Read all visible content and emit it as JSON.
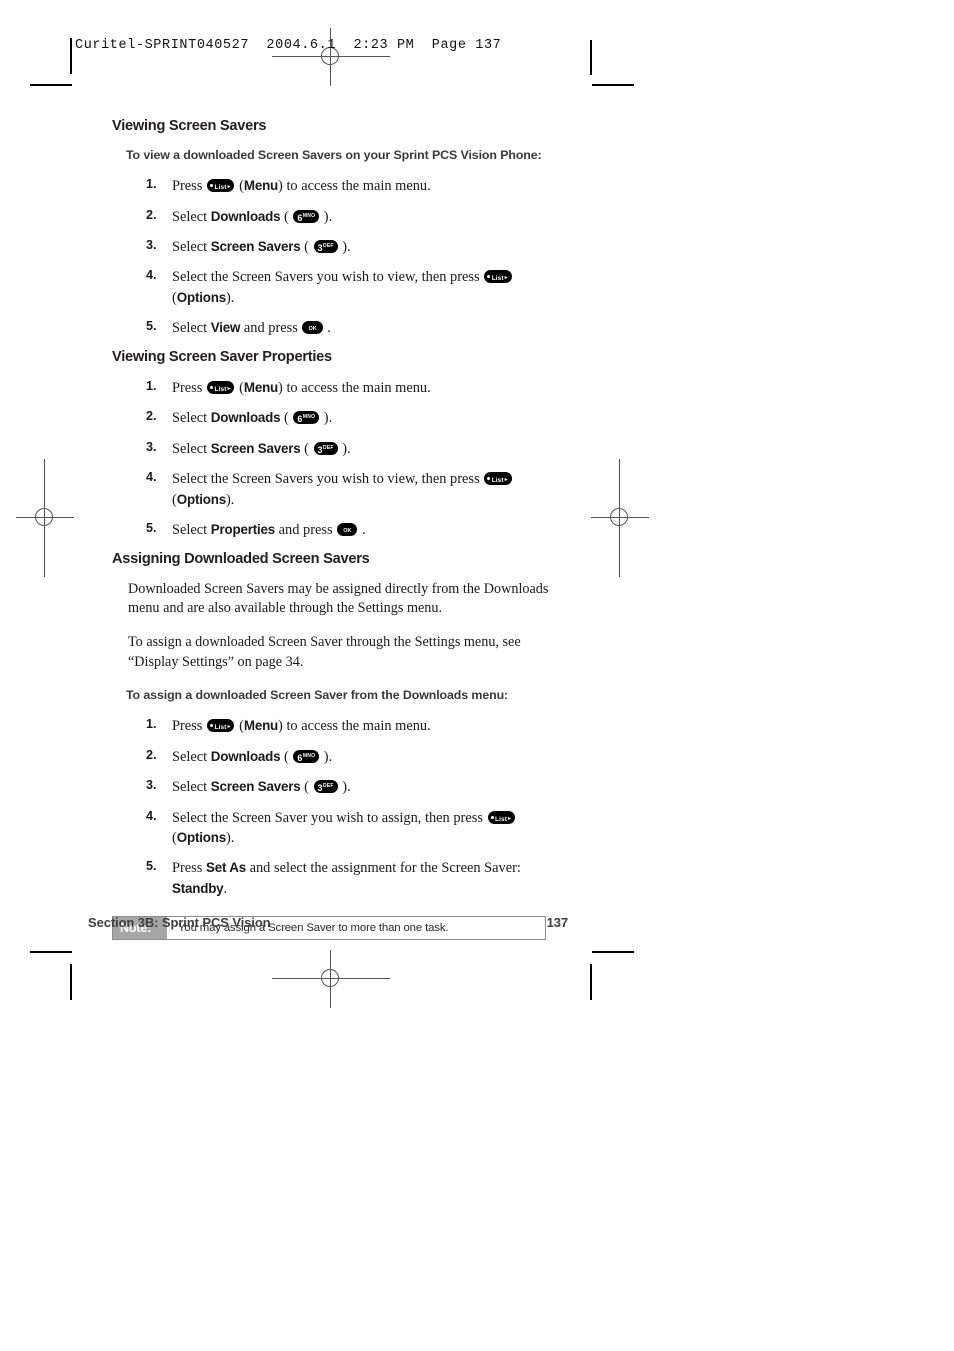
{
  "print_slug": "Curitel-SPRINT040527  2004.6.1  2:23 PM  Page 137",
  "sections": [
    {
      "heading": "Viewing Screen Savers",
      "lead": "To view a downloaded Screen Savers on your Sprint PCS Vision Phone:",
      "steps": [
        {
          "num": "1.",
          "pre": "Press",
          "key": "list",
          "post_bold": "Menu",
          "post": "to access the main menu."
        },
        {
          "num": "2.",
          "pre": "Select",
          "bold": "Downloads",
          "key": "6",
          "key_digit": "6",
          "key_sub": "MNO"
        },
        {
          "num": "3.",
          "pre": "Select",
          "bold": "Screen Savers",
          "key": "3",
          "key_digit": "3",
          "key_sub": "DEF"
        },
        {
          "num": "4.",
          "pre": "Select the Screen Savers you wish to view, then press",
          "key": "list",
          "post_bold": "Options",
          "post": ""
        },
        {
          "num": "5.",
          "pre": "Select",
          "bold": "View",
          "mid": "and press",
          "key": "ok"
        }
      ]
    },
    {
      "heading": "Viewing Screen Saver Properties",
      "steps": [
        {
          "num": "1.",
          "pre": "Press",
          "key": "list",
          "post_bold": "Menu",
          "post": "to access the main menu."
        },
        {
          "num": "2.",
          "pre": "Select",
          "bold": "Downloads",
          "key": "6",
          "key_digit": "6",
          "key_sub": "MNO"
        },
        {
          "num": "3.",
          "pre": "Select",
          "bold": "Screen Savers",
          "key": "3",
          "key_digit": "3",
          "key_sub": "DEF"
        },
        {
          "num": "4.",
          "pre": "Select the Screen Savers you wish to view, then press",
          "key": "list",
          "post_bold": "Options",
          "post": ""
        },
        {
          "num": "5.",
          "pre": "Select",
          "bold": "Properties",
          "mid": "and press",
          "key": "ok"
        }
      ]
    },
    {
      "heading": "Assigning Downloaded Screen Savers",
      "paragraphs": [
        "Downloaded Screen Savers may be assigned directly from the Downloads menu and are also available through the Settings menu.",
        "To assign a downloaded Screen Saver through the Settings menu, see “Display Settings” on page 34."
      ],
      "lead": "To assign a downloaded Screen Saver from the Downloads menu:",
      "steps": [
        {
          "num": "1.",
          "pre": "Press",
          "key": "list",
          "post_bold": "Menu",
          "post": "to access the main menu."
        },
        {
          "num": "2.",
          "pre": "Select",
          "bold": "Downloads",
          "key": "6",
          "key_digit": "6",
          "key_sub": "MNO"
        },
        {
          "num": "3.",
          "pre": "Select",
          "bold": "Screen Savers",
          "key": "3",
          "key_digit": "3",
          "key_sub": "DEF"
        },
        {
          "num": "4.",
          "pre": "Select the Screen Saver you wish to assign, then press",
          "key": "list",
          "post_bold": "Options",
          "post": ""
        },
        {
          "num": "5.",
          "pre": "Press",
          "bold": "Set As",
          "mid": "and select the assignment for the Screen Saver:",
          "tail_bold": "Standby",
          "tail": "."
        }
      ]
    }
  ],
  "note": {
    "label": "Note:",
    "text": "You may assign a Screen Saver to more than one task."
  },
  "footer": {
    "left": "Section 3B: Sprint PCS Vision",
    "page": "137"
  },
  "keys": {
    "list_text": "List",
    "ok_top": "OK",
    "ok_bottom": "•"
  }
}
